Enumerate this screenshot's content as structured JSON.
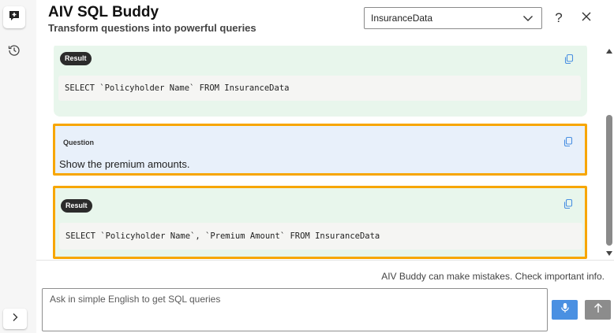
{
  "header": {
    "title": "AIV SQL Buddy",
    "subtitle": "Transform questions into powerful queries",
    "database_select": {
      "selected": "InsuranceData"
    },
    "help_label": "?"
  },
  "messages": [
    {
      "type": "result",
      "label": "Result",
      "sql": "SELECT `Policyholder Name` FROM InsuranceData"
    },
    {
      "type": "question",
      "label": "Question",
      "text": "Show the premium amounts."
    },
    {
      "type": "result",
      "label": "Result",
      "sql": "SELECT `Policyholder Name`, `Premium Amount` FROM InsuranceData"
    }
  ],
  "footer": {
    "disclaimer": "AIV Buddy can make mistakes. Check important info.",
    "input_placeholder": "Ask in simple English to get SQL queries",
    "input_value": ""
  },
  "icons": {
    "new_chat": "new-chat-icon",
    "history": "history-icon",
    "expand": "chevron-right-icon",
    "copy": "copy-icon",
    "mic": "microphone-icon",
    "send": "arrow-up-icon",
    "close": "close-icon",
    "dropdown": "chevron-down-icon"
  },
  "colors": {
    "result_bg": "#e8f6ec",
    "question_bg": "#e8f0fa",
    "highlight_border": "#f7a600",
    "mic_button": "#4a90e2",
    "send_button": "#8c8c8c",
    "copy_icon": "#4a90e2"
  }
}
